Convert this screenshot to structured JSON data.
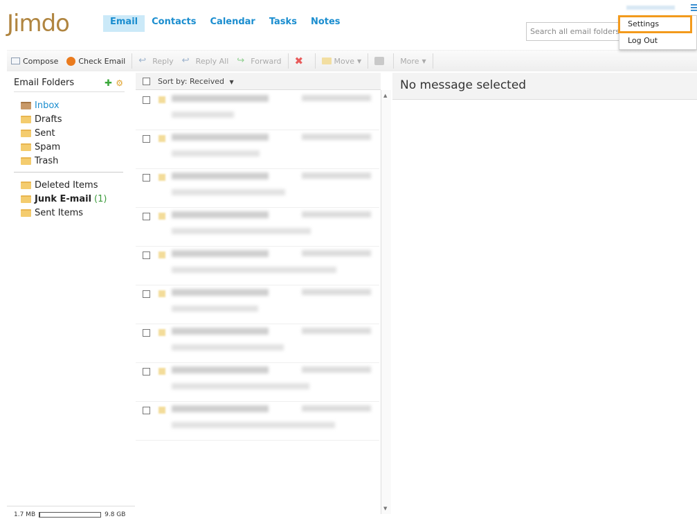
{
  "app": {
    "logo_text": "Jimdo"
  },
  "nav": {
    "tabs": [
      "Email",
      "Contacts",
      "Calendar",
      "Tasks",
      "Notes"
    ],
    "active": "Email"
  },
  "search": {
    "placeholder": "Search all email folders"
  },
  "user_menu": {
    "items": [
      "Settings",
      "Log Out"
    ],
    "highlighted": "Settings"
  },
  "toolbar": {
    "compose": "Compose",
    "check_email": "Check Email",
    "reply": "Reply",
    "reply_all": "Reply All",
    "forward": "Forward",
    "move": "Move",
    "more": "More"
  },
  "sidebar": {
    "title": "Email Folders",
    "folders": [
      "Inbox",
      "Drafts",
      "Sent",
      "Spam",
      "Trash"
    ],
    "other_folders": [
      "Deleted Items",
      "Junk E-mail",
      "Sent Items"
    ],
    "junk_count": "(1)",
    "quota": {
      "used": "1.7 MB",
      "total": "9.8 GB",
      "fill_fraction": 0.01
    }
  },
  "list": {
    "sort_label": "Sort by:",
    "sort_value": "Received",
    "row_count": 9
  },
  "preview": {
    "empty_text": "No message selected"
  },
  "colors": {
    "accent": "#1a8dcf",
    "highlight": "#f39a1c",
    "active_tab": "#cbe9f8"
  }
}
